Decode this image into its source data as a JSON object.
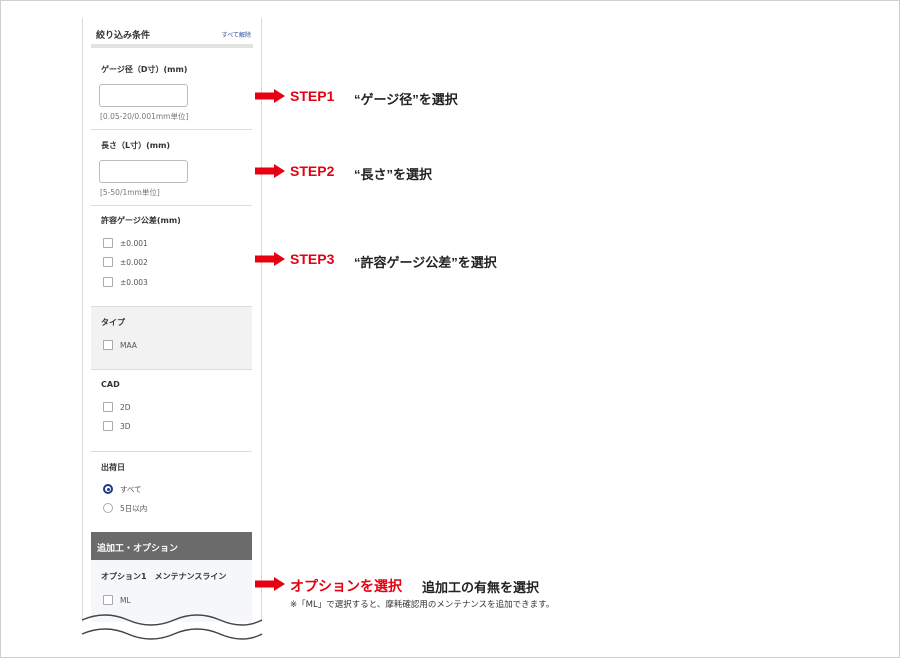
{
  "panel": {
    "title": "絞り込み条件",
    "clear_all": "すべて解除",
    "gauge_diameter": {
      "label": "ゲージ径（D寸）(mm)",
      "value": "",
      "hint": "[0.05-20/0.001mm単位]"
    },
    "length": {
      "label": "長さ（L寸）(mm)",
      "value": "",
      "hint": "[5-50/1mm単位]"
    },
    "tolerance": {
      "label": "許容ゲージ公差(mm)",
      "options": [
        "±0.001",
        "±0.002",
        "±0.003"
      ]
    },
    "type": {
      "label": "タイプ",
      "options": [
        "MAA"
      ]
    },
    "cad": {
      "label": "CAD",
      "options": [
        "2D",
        "3D"
      ]
    },
    "ship_day": {
      "label": "出荷日",
      "options": [
        "すべて",
        "5日以内"
      ],
      "selected": "すべて"
    },
    "addon": {
      "title": "追加工・オプション",
      "option1_label": "オプション1　メンテナンスライン",
      "options": [
        "ML"
      ]
    }
  },
  "annotations": {
    "step1": {
      "tag": "STEP1",
      "text": "“ゲージ径”を選択"
    },
    "step2": {
      "tag": "STEP2",
      "text": "“長さ”を選択"
    },
    "step3": {
      "tag": "STEP3",
      "text": "“許容ゲージ公差”を選択"
    },
    "option": {
      "tag": "オプションを選択",
      "text": "追加工の有無を選択",
      "note": "※「ML」で選択すると、摩耗確認用のメンテナンスを追加できます。"
    }
  },
  "colors": {
    "accent_red": "#e60012",
    "radio_blue": "#1d3a8c",
    "addon_bar": "#6b6b6b"
  },
  "icons": {
    "arrow": "arrow-right-icon"
  }
}
